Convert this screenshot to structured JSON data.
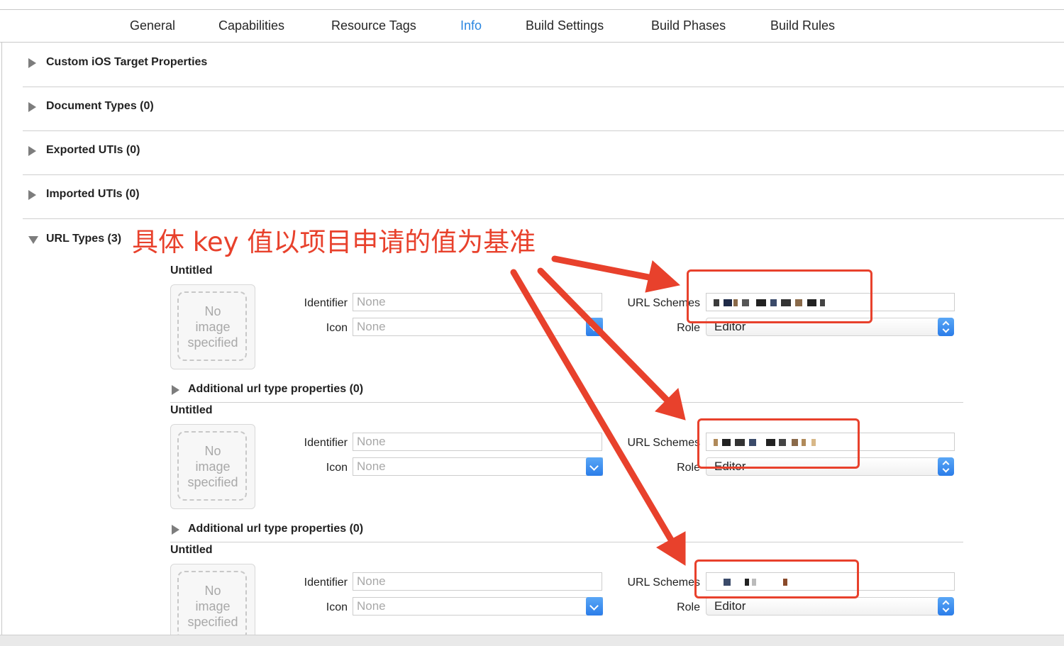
{
  "tabs": [
    {
      "label": "General"
    },
    {
      "label": "Capabilities"
    },
    {
      "label": "Resource Tags"
    },
    {
      "label": "Info",
      "active": true
    },
    {
      "label": "Build Settings"
    },
    {
      "label": "Build Phases"
    },
    {
      "label": "Build Rules"
    }
  ],
  "sections": [
    {
      "title": "Custom iOS Target Properties"
    },
    {
      "title": "Document Types (0)"
    },
    {
      "title": "Exported UTIs (0)"
    },
    {
      "title": "Imported UTIs (0)"
    }
  ],
  "url_types": {
    "title": "URL Types (3)",
    "annotation": "具体 key 值以项目申请的值为基准",
    "labels": {
      "identifier": "Identifier",
      "icon": "Icon",
      "url_schemes": "URL Schemes",
      "role": "Role",
      "no_image": "No\nimage\nspecified",
      "additional": "Additional url type properties (0)"
    },
    "entries": [
      {
        "title": "Untitled",
        "identifier_placeholder": "None",
        "icon_placeholder": "None",
        "role": "Editor",
        "url_schemes_redacted": true
      },
      {
        "title": "Untitled",
        "identifier_placeholder": "None",
        "icon_placeholder": "None",
        "role": "Editor",
        "url_schemes_redacted": true
      },
      {
        "title": "Untitled",
        "identifier_placeholder": "None",
        "icon_placeholder": "None",
        "role": "Editor",
        "url_schemes_redacted": true
      }
    ]
  },
  "colors": {
    "accent": "#2a86e0",
    "annotation": "#e8412c"
  }
}
